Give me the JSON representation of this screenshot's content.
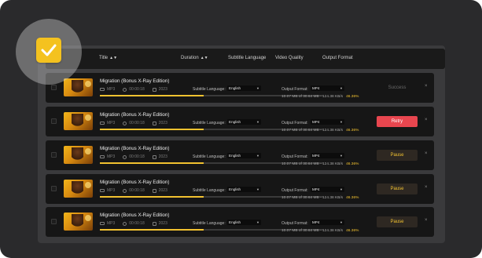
{
  "header": {
    "title": "Title",
    "duration": "Duration",
    "subtitle_language": "Subtitle Language",
    "video_quality": "Video Quality",
    "output_format": "Output Format"
  },
  "rows": [
    {
      "title": "Migration (Bonus X-Ray Edition)",
      "format": "MP3",
      "duration": "00:00:18",
      "year": "2023",
      "subtitle_label": "Subtitle Language:",
      "subtitle_value": "English",
      "format_label": "Output Format:",
      "format_value": "MP4",
      "size_text": "10.07 MB of 30.64 MB - 124.38 KB/s",
      "percent_text": "46.36%",
      "progress": 0.4636,
      "action": "Success",
      "action_type": "success"
    },
    {
      "title": "Migration (Bonus X-Ray Edition)",
      "format": "MP3",
      "duration": "00:00:18",
      "year": "2023",
      "subtitle_label": "Subtitle Language:",
      "subtitle_value": "English",
      "format_label": "Output Format:",
      "format_value": "MP4",
      "size_text": "10.07 MB of 30.64 MB - 124.38 KB/s",
      "percent_text": "46.36%",
      "progress": 0.4636,
      "action": "Retry",
      "action_type": "retry"
    },
    {
      "title": "Migration (Bonus X-Ray Edition)",
      "format": "MP3",
      "duration": "00:00:18",
      "year": "2023",
      "subtitle_label": "Subtitle Language:",
      "subtitle_value": "English",
      "format_label": "Output Format:",
      "format_value": "MP4",
      "size_text": "10.07 MB of 30.64 MB - 124.38 KB/s",
      "percent_text": "46.36%",
      "progress": 0.4636,
      "action": "Pause",
      "action_type": "pause"
    },
    {
      "title": "Migration (Bonus X-Ray Edition)",
      "format": "MP3",
      "duration": "00:00:18",
      "year": "2023",
      "subtitle_label": "Subtitle Language:",
      "subtitle_value": "English",
      "format_label": "Output Format:",
      "format_value": "MP4",
      "size_text": "10.07 MB of 30.64 MB - 124.38 KB/s",
      "percent_text": "46.36%",
      "progress": 0.4636,
      "action": "Pause",
      "action_type": "pause"
    },
    {
      "title": "Migration (Bonus X-Ray Edition)",
      "format": "MP3",
      "duration": "00:00:18",
      "year": "2023",
      "subtitle_label": "Subtitle Language:",
      "subtitle_value": "English",
      "format_label": "Output Format:",
      "format_value": "MP4",
      "size_text": "10.07 MB of 30.64 MB - 124.38 KB/s",
      "percent_text": "46.36%",
      "progress": 0.4636,
      "action": "Pause",
      "action_type": "pause"
    }
  ],
  "colors": {
    "accent": "#f2c230",
    "retry": "#e8464f",
    "row_background": "#161616",
    "panel_background": "#3a3a3c"
  },
  "icons": {
    "select_all": "checkmark-icon",
    "format": "video-icon",
    "duration": "clock-icon",
    "year": "calendar-icon",
    "remove": "close-icon",
    "sort": "sort-icon"
  }
}
